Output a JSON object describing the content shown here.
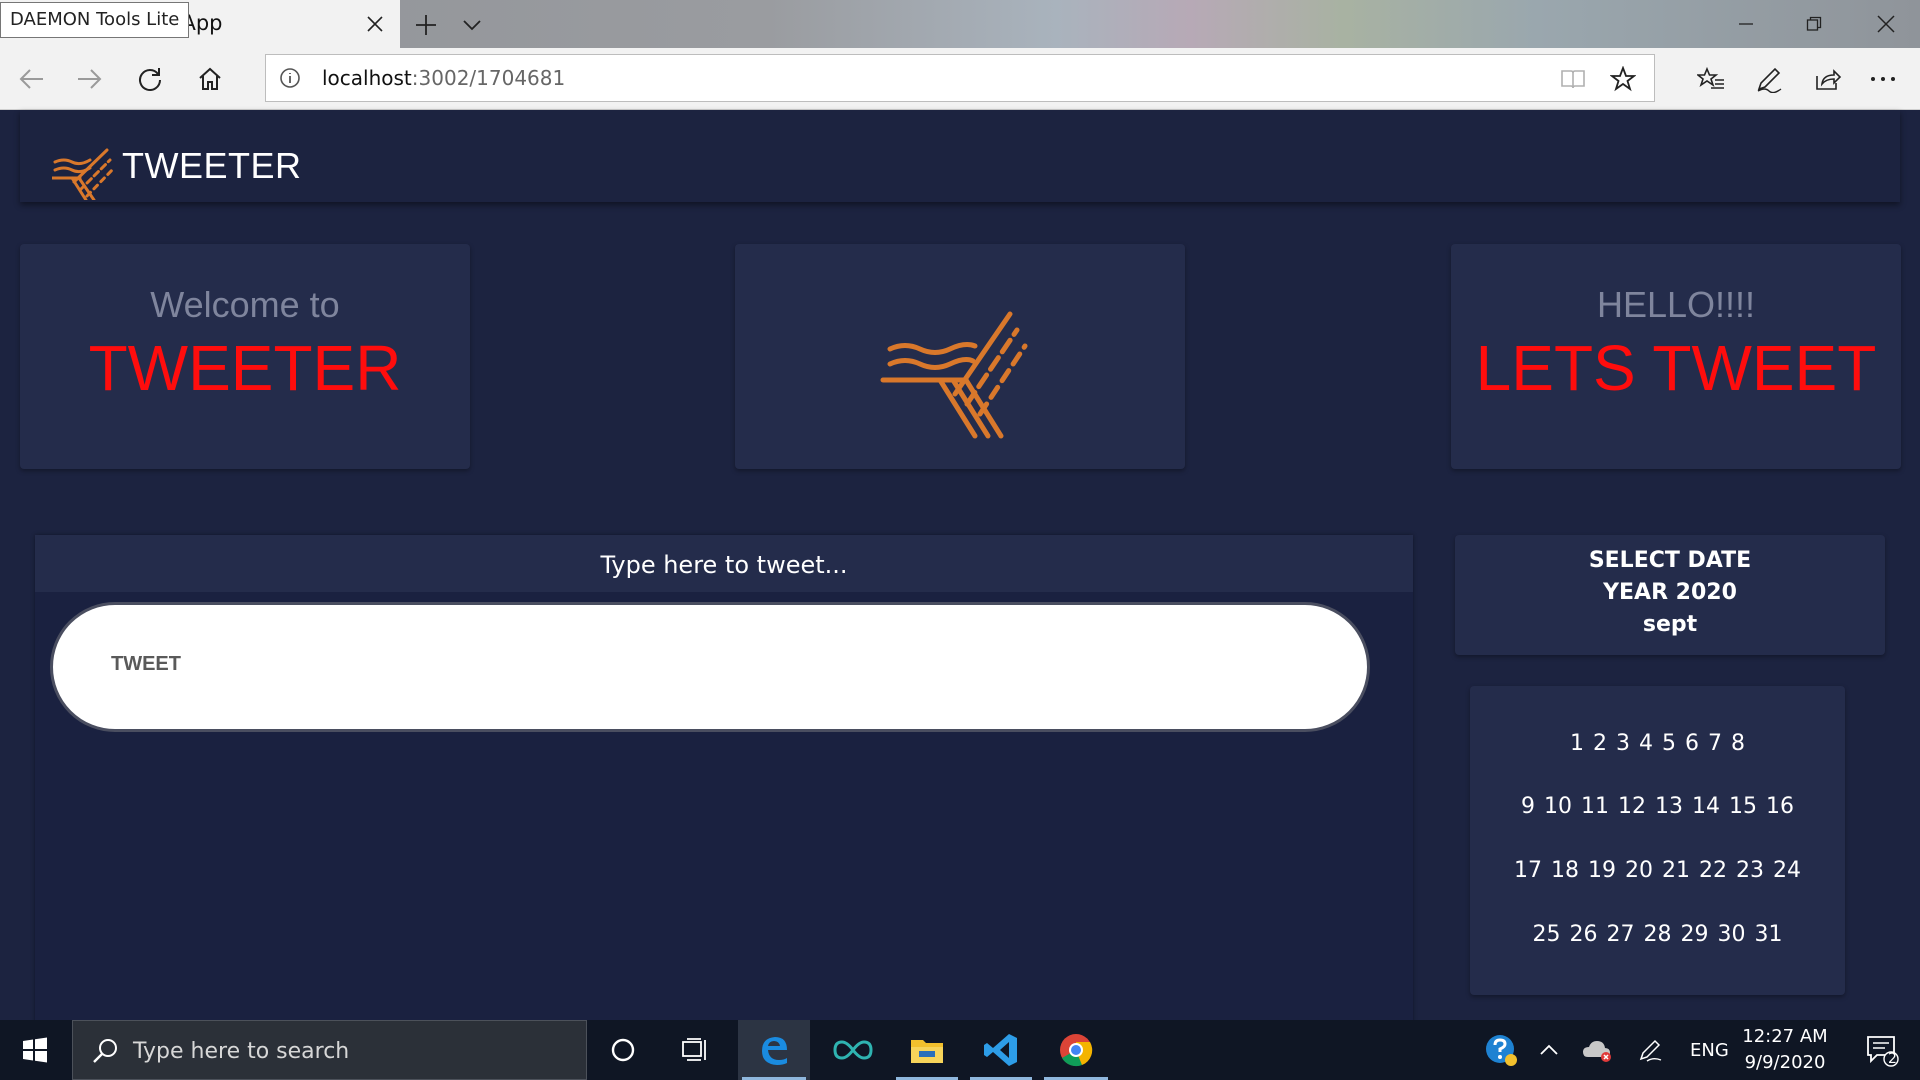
{
  "browser": {
    "tab_title": "React App",
    "tab_title_visible": "ct App",
    "tooltip": "DAEMON Tools Lite",
    "url_host": "localhost",
    "url_rest": ":3002/1704681"
  },
  "header": {
    "title": "TWEETER"
  },
  "cards": {
    "left_small": "Welcome to",
    "left_big": "TWEETER",
    "right_small": "HELLO!!!!",
    "right_big": "LETS TWEET"
  },
  "tweet": {
    "heading": "Type here to tweet...",
    "button_label": "TWEET"
  },
  "date": {
    "line1": "SELECT DATE",
    "line2": "YEAR 2020",
    "line3": "sept"
  },
  "calendar": {
    "rows": [
      "1 2 3 4 5 6 7 8",
      "9 10 11 12 13 14 15 16",
      "17 18 19 20 21 22 23 24",
      "25 26 27 28 29 30 31"
    ]
  },
  "taskbar": {
    "search_placeholder": "Type here to search",
    "language": "ENG",
    "time": "12:27 AM",
    "date": "9/9/2020",
    "notification_count": "2"
  },
  "colors": {
    "page_bg": "#1c2340",
    "card_bg": "#242c4b",
    "accent_red": "#ff0d0d",
    "logo_orange": "#d9782b"
  },
  "icons": [
    "close-icon",
    "plus-icon",
    "chevron-down-icon",
    "minimize-icon",
    "restore-icon",
    "back-icon",
    "forward-icon",
    "refresh-icon",
    "home-icon",
    "info-icon",
    "reading-view-icon",
    "star-icon",
    "favorites-icon",
    "pen-icon",
    "share-icon",
    "more-icon",
    "tweeter-logo-icon",
    "windows-icon",
    "search-icon",
    "cortana-icon",
    "task-view-icon",
    "edge-icon",
    "infinity-icon",
    "file-explorer-icon",
    "vscode-icon",
    "chrome-icon",
    "help-icon",
    "chevron-up-icon",
    "cloud-icon",
    "pen-tray-icon",
    "notification-icon"
  ]
}
